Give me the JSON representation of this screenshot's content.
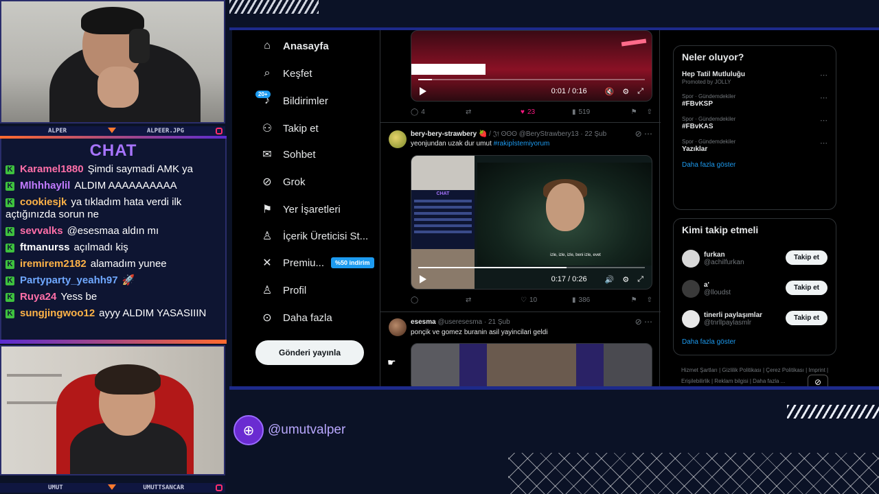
{
  "stream": {
    "cam_top": {
      "left": "ALPER",
      "right": "ALPEER.JPG"
    },
    "cam_bottom": {
      "left": "UMUT",
      "right": "UMUTTSANCAR"
    },
    "handle": "@umutvalper"
  },
  "chat": {
    "title": "CHAT",
    "messages": [
      {
        "user": "Karamel1880",
        "color": "#ff6fa8",
        "text": "Şimdi saymadi AMK ya"
      },
      {
        "user": "Mlhhhaylil",
        "color": "#c27bff",
        "text": "ALDIM AAAAAAAAAA"
      },
      {
        "user": "cookiesjk",
        "color": "#ffb347",
        "text": "ya tıkladım hata verdi ilk açtığınızda sorun ne"
      },
      {
        "user": "sevvalks",
        "color": "#ff6fa8",
        "text": "@esesmaa aldın mı"
      },
      {
        "user": "ftmanurss",
        "color": "#ffffff",
        "text": "açılmadı kiş"
      },
      {
        "user": "iremirem2182",
        "color": "#ffb347",
        "text": "alamadım yunee"
      },
      {
        "user": "Partyparty_yeahh97",
        "color": "#6fa8ff",
        "text": "🚀"
      },
      {
        "user": "Ruya24",
        "color": "#ff6fa8",
        "text": "Yess be"
      },
      {
        "user": "sungjingwoo12",
        "color": "#ffb347",
        "text": "ayyy ALDIM YASASIIIN"
      }
    ]
  },
  "nav": {
    "items": [
      {
        "label": "Anasayfa",
        "icon": "home-icon",
        "glyph": "⌂"
      },
      {
        "label": "Keşfet",
        "icon": "search-icon",
        "glyph": "⌕"
      },
      {
        "label": "Bildirimler",
        "icon": "bell-icon",
        "glyph": "♪"
      },
      {
        "label": "Takip et",
        "icon": "add-person-icon",
        "glyph": "⚇"
      },
      {
        "label": "Sohbet",
        "icon": "mail-icon",
        "glyph": "✉"
      },
      {
        "label": "Grok",
        "icon": "grok-icon",
        "glyph": "⊘"
      },
      {
        "label": "Yer İşaretleri",
        "icon": "bookmark-icon",
        "glyph": "⚑"
      },
      {
        "label": "İçerik Üreticisi St...",
        "icon": "creator-icon",
        "glyph": "♙"
      },
      {
        "label": "Premiu...",
        "icon": "x-logo-icon",
        "glyph": "✕"
      },
      {
        "label": "Profil",
        "icon": "profile-icon",
        "glyph": "♙"
      },
      {
        "label": "Daha fazla",
        "icon": "more-icon",
        "glyph": "⊙"
      }
    ],
    "notif_badge": "20+",
    "premium_badge": "%50 indirim",
    "post_button": "Gönderi yayınla"
  },
  "feed": {
    "post1": {
      "video_time": "0:01 / 0:16",
      "progress": 0.06,
      "replies": "4",
      "reposts": "",
      "likes": "23",
      "views": "519"
    },
    "post2": {
      "name": "bery-bery-strawbery",
      "badge": "🍓 / 𝔍𝔣 ʘʘʘ",
      "handle": "@BeryStrawbery13 · 22 Şub",
      "text": "yeonjundan uzak dur umut",
      "hashtag": "#rakipİstemiyorum",
      "mini_chat_title": "CHAT",
      "caption": "izle, izle, izle, beni izle, evet",
      "video_time": "0:17 / 0:26",
      "progress": 0.65,
      "replies": "",
      "reposts": "",
      "likes": "10",
      "views": "386"
    },
    "post3": {
      "name": "esesma",
      "handle": "@useresesma · 21 Şub",
      "text": "ponçik ve gomez buranin asil yayincilari geldi"
    }
  },
  "right": {
    "trends_title": "Neler oluyor?",
    "trends": [
      {
        "cat": "",
        "name": "Hep Tatil Mutluluğu",
        "sub": "Promoted by JOLLY"
      },
      {
        "cat": "Spor · Gündemdekiler",
        "name": "#FBvKSP",
        "sub": ""
      },
      {
        "cat": "Spor · Gündemdekiler",
        "name": "#FBvKAS",
        "sub": ""
      },
      {
        "cat": "Spor · Gündemdekiler",
        "name": "Yazıklar",
        "sub": ""
      }
    ],
    "show_more": "Daha fazla göster",
    "follow_title": "Kimi takip etmeli",
    "follow": [
      {
        "name": "furkan",
        "handle": "@achilfurkan",
        "button": "Takip et",
        "color": "#d8d8d8"
      },
      {
        "name": "a'",
        "handle": "@lloudst",
        "button": "Takip et",
        "color": "#3a3a3a"
      },
      {
        "name": "tinerli paylaşımlar",
        "handle": "@tnrllpaylasmlr",
        "button": "Takip et",
        "color": "#e8e8e8"
      }
    ],
    "show_more2": "Daha fazla göster",
    "footer": "Hizmet Şartları  |  Gizlilik Politikası  |  Çerez Politikası  |  Imprint  |  Erişilebilirlik  |  Reklam bilgisi  |  Daha fazla ..."
  }
}
